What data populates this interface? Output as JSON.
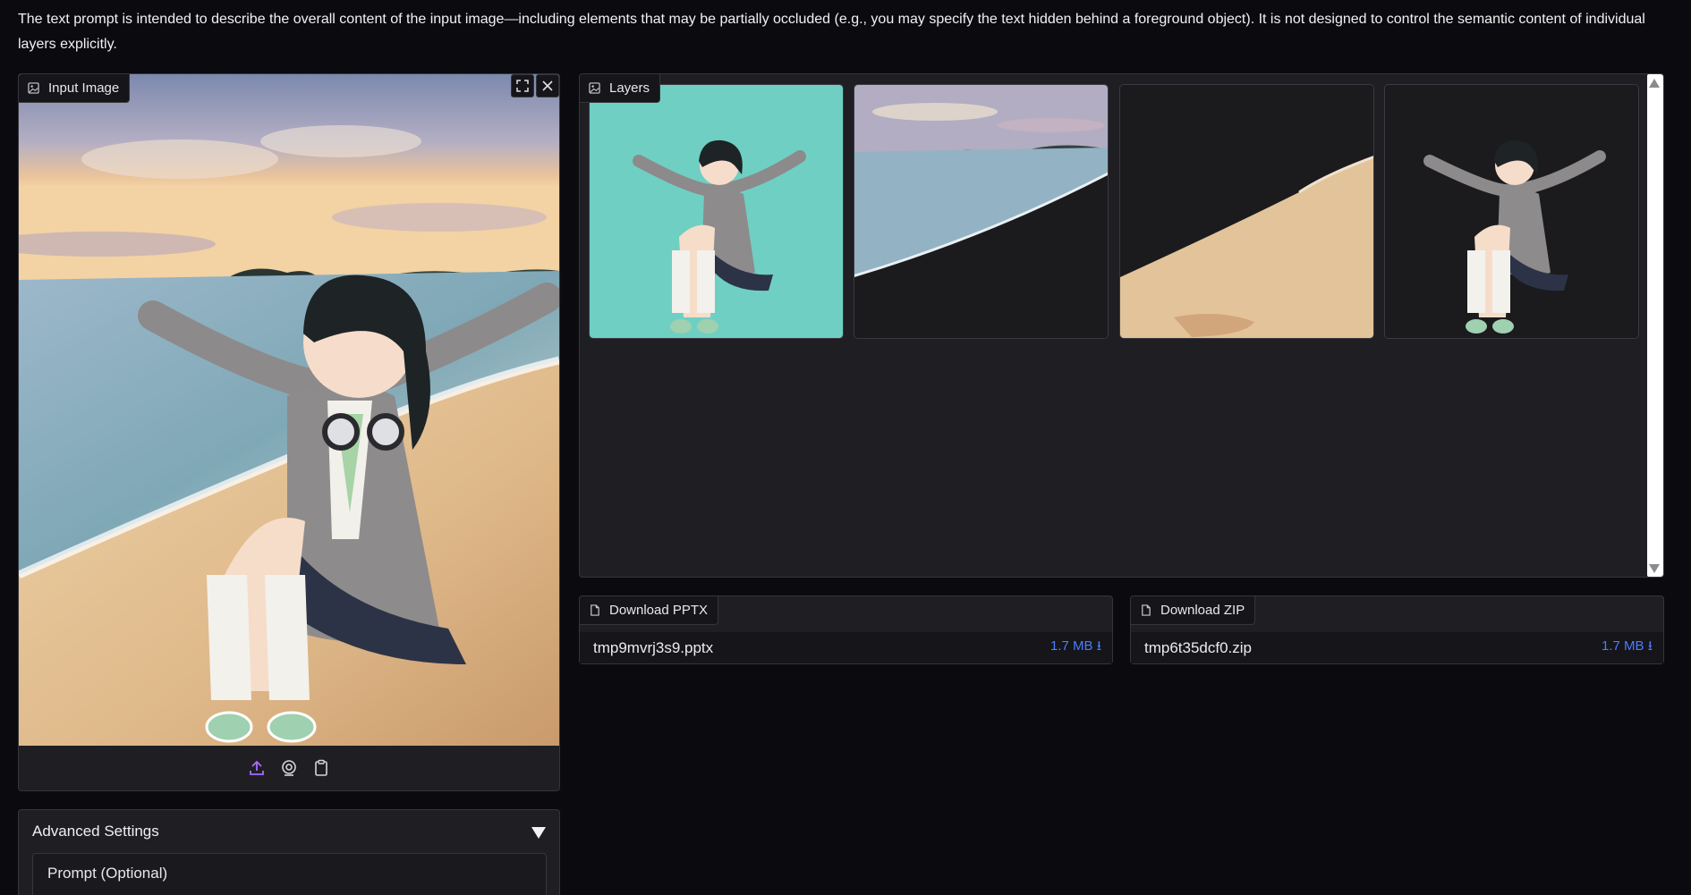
{
  "description": "The text prompt is intended to describe the overall content of the input image—including elements that may be partially occluded (e.g., you may specify the text hidden behind a foreground object). It is not designed to control the semantic content of individual layers explicitly.",
  "input_image": {
    "label": "Input Image",
    "tools": [
      "fullscreen-icon",
      "close-icon"
    ],
    "footer_tools": [
      "upload-icon",
      "webcam-icon",
      "clipboard-icon"
    ]
  },
  "advanced": {
    "title": "Advanced Settings",
    "prompt_label": "Prompt (Optional)"
  },
  "layers": {
    "label": "Layers",
    "items": [
      "layer-1",
      "layer-2",
      "layer-3",
      "layer-4"
    ]
  },
  "downloads": [
    {
      "label": "Download PPTX",
      "file": "tmp9mvrj3s9.pptx",
      "size": "1.7 MB",
      "icon": "download-arrow-icon"
    },
    {
      "label": "Download ZIP",
      "file": "tmp6t35dcf0.zip",
      "size": "1.7 MB",
      "icon": "download-arrow-icon"
    }
  ],
  "colors": {
    "background": "#0b0b0f",
    "panel": "#1f1f23",
    "accent": "#4a7dff",
    "upload_accent": "#a86bff"
  }
}
